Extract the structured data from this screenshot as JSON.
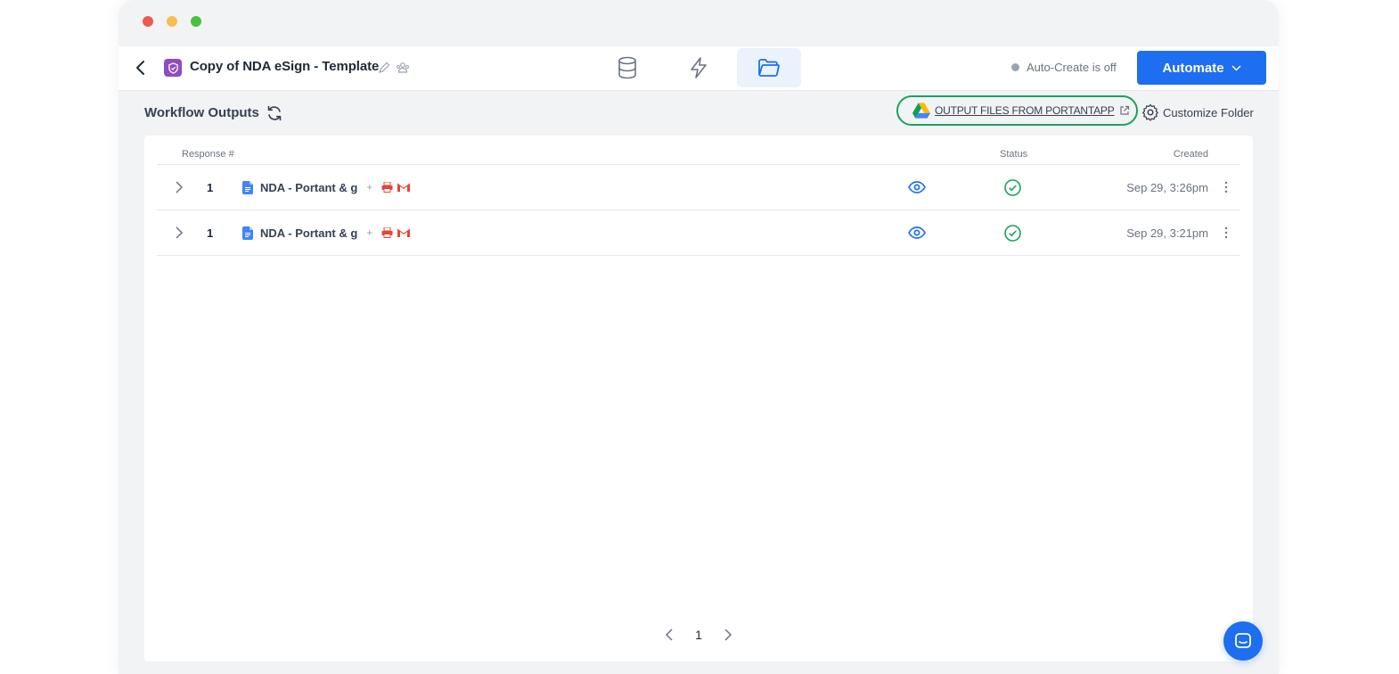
{
  "window": {
    "controls": [
      "close",
      "minimize",
      "maximize"
    ]
  },
  "appbar": {
    "title": "Copy of NDA eSign - Template",
    "tabs": [
      {
        "name": "data-source-icon",
        "active": false
      },
      {
        "name": "automation-icon",
        "active": false
      },
      {
        "name": "folder-icon",
        "active": true
      }
    ],
    "auto_create_status": "Auto-Create is off",
    "automate_label": "Automate"
  },
  "toolbar": {
    "title": "Workflow Outputs",
    "drive_link_label": "OUTPUT FILES FROM PORTANTAPP",
    "customize_label": "Customize Folder"
  },
  "table": {
    "columns": {
      "response": "Response #",
      "status": "Status",
      "created": "Created"
    },
    "rows": [
      {
        "response": "1",
        "document": "NDA - Portant & g",
        "extra": "+",
        "status": "success",
        "created": "Sep 29, 3:26pm"
      },
      {
        "response": "1",
        "document": "NDA - Portant & g",
        "extra": "+",
        "status": "success",
        "created": "Sep 29, 3:21pm"
      }
    ]
  },
  "pagination": {
    "current_page": "1"
  },
  "colors": {
    "accent": "#1d6ef0",
    "success": "#1aa260",
    "app_badge": "#8e4bc2"
  }
}
